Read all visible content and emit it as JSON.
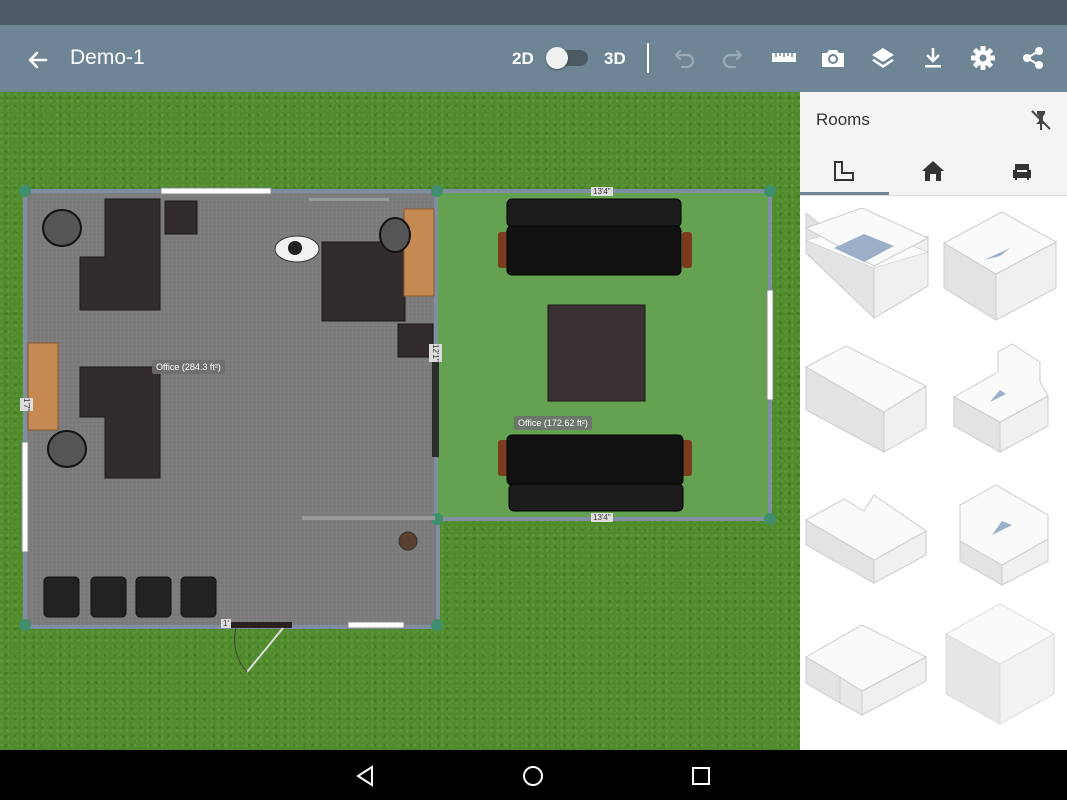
{
  "toolbar": {
    "title": "Demo-1",
    "mode_2d": "2D",
    "mode_3d": "3D",
    "view_mode": "2D",
    "icons": [
      "back-arrow-icon",
      "undo-icon",
      "redo-icon",
      "ruler-icon",
      "camera-icon",
      "layers-icon",
      "download-icon",
      "gear-icon",
      "share-icon"
    ]
  },
  "floorplan": {
    "rooms": [
      {
        "label": "Office (284.3 ft²)",
        "floor": "grey carpet"
      },
      {
        "label": "Office (172.62 ft²)",
        "floor": "green"
      }
    ],
    "dimensions": [
      "13'4\"",
      "13'4\"",
      "12'1\"",
      "1'7\"",
      "1'"
    ]
  },
  "panel": {
    "title": "Rooms",
    "tabs": [
      "room-shape-icon",
      "house-icon",
      "furniture-icon"
    ],
    "active_tab": 0,
    "room_shapes": [
      "rectangle-room",
      "square-room",
      "long-room",
      "notched-room",
      "l-shaped-room",
      "u-shaped-room",
      "t-shaped-room",
      "solid-block"
    ]
  },
  "colors": {
    "toolbar": "#6d8594",
    "statusbar": "#4c5b65",
    "grass": "#4f8a2c",
    "office_floor": "#7c7c7c",
    "green_room_floor": "#64a150",
    "desk": "#322c2c",
    "cabinet": "#c48a52"
  }
}
